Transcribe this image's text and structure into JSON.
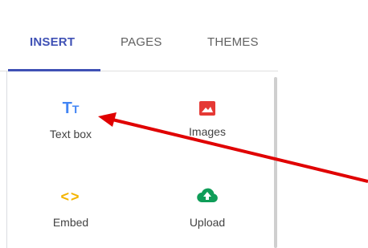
{
  "tabs": [
    {
      "label": "INSERT",
      "active": true
    },
    {
      "label": "PAGES",
      "active": false
    },
    {
      "label": "THEMES",
      "active": false
    }
  ],
  "insert_items": [
    {
      "label": "Text box",
      "icon": "text-box-icon"
    },
    {
      "label": "Images",
      "icon": "image-icon"
    },
    {
      "label": "Embed",
      "icon": "embed-code-icon"
    },
    {
      "label": "Upload",
      "icon": "upload-cloud-icon"
    }
  ],
  "colors": {
    "accent": "#3f51b5",
    "text_box_icon": "#4285f4",
    "images_icon": "#e53935",
    "embed_icon": "#f4b400",
    "upload_icon": "#0f9d58",
    "annotation_arrow": "#e00000"
  }
}
